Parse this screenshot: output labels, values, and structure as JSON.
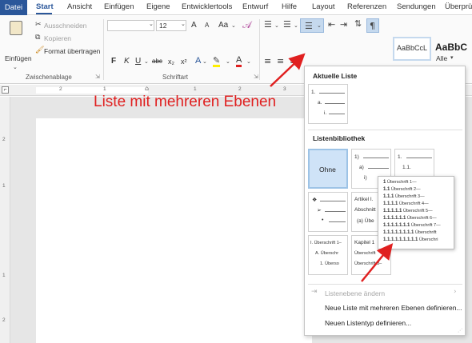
{
  "tabs": [
    "Datei",
    "Start",
    "Ansicht",
    "Einfügen",
    "Eigene",
    "Entwicklertools",
    "Entwurf",
    "Hilfe",
    "Layout",
    "Referenzen",
    "Sendungen",
    "Überprü"
  ],
  "clipboard": {
    "paste": "Einfügen",
    "cut": "Ausschneiden",
    "copy": "Kopieren",
    "format_painter": "Format übertragen",
    "group": "Zwischenablage"
  },
  "font": {
    "size": "12",
    "group": "Schriftart",
    "grow": "A",
    "aa": "Aa",
    "bold": "F",
    "italic": "K",
    "underline": "U",
    "strike": "abc",
    "sub": "x₂",
    "sup": "x²"
  },
  "styles": {
    "style1": "AaBbCcL",
    "style2": "AaBbC",
    "all": "Alle"
  },
  "annotation": "Liste mit mehreren Ebenen",
  "menu": {
    "current_header": "Aktuelle Liste",
    "current_list": [
      "1.",
      "a.",
      "i."
    ],
    "library_header": "Listenbibliothek",
    "none": "Ohne",
    "cell2": [
      "1)",
      "a)",
      "i)"
    ],
    "cell3": [
      "1.",
      "1.1."
    ],
    "cell5": [
      "Artikel I.",
      "Abschnitt",
      "(a) Übe"
    ],
    "cell7": [
      "I. Überschrift 1–",
      "A. Überschr",
      "1. Überso"
    ],
    "cell8": [
      "Kapitel 1",
      "Überschrift",
      "Überschrift 3–"
    ],
    "change_level": "Listenebene ändern",
    "define_multi": "Neue Liste mit mehreren Ebenen definieren...",
    "define_style": "Neuen Listentyp definieren..."
  },
  "preview": [
    {
      "num": "1",
      "text": "Überschrift 1"
    },
    {
      "num": "1.1",
      "text": "Überschrift 2"
    },
    {
      "num": "1.1.1",
      "text": "Überschrift 3"
    },
    {
      "num": "1.1.1.1",
      "text": "Überschrift 4"
    },
    {
      "num": "1.1.1.1.1",
      "text": "Überschrift 5"
    },
    {
      "num": "1.1.1.1.1.1",
      "text": "Überschrift 6"
    },
    {
      "num": "1.1.1.1.1.1.1",
      "text": "Überschrift 7"
    },
    {
      "num": "1.1.1.1.1.1.1.1",
      "text": "Überschrift"
    },
    {
      "num": "1.1.1.1.1.1.1.1.1",
      "text": "Überschri"
    }
  ],
  "ruler": [
    "2",
    "1",
    "1",
    "2",
    "3",
    "4",
    "5"
  ],
  "vruler": [
    "2",
    "1",
    "1",
    "2"
  ],
  "colors": {
    "accent": "#2b579a",
    "annotation": "#e02020",
    "highlight": "#cfe3f7"
  }
}
